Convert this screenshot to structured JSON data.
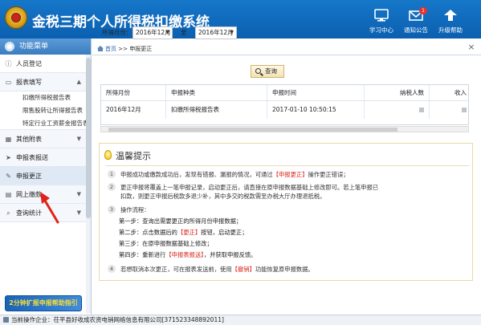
{
  "header": {
    "title": "金税三期个人所得税扣缴系统",
    "buttons": [
      {
        "label": "学习中心",
        "icon": "monitor-icon"
      },
      {
        "label": "通知公告",
        "icon": "mail-icon",
        "badge": "1"
      },
      {
        "label": "升级帮助",
        "icon": "upgrade-icon"
      }
    ]
  },
  "sidebar": {
    "heading": "功能菜单",
    "sections": [
      {
        "label": "人员登记",
        "icon": "info-icon"
      },
      {
        "label": "报表填写",
        "icon": "form-icon",
        "items": [
          "扣缴所得税报告表",
          "限售股转让所得报告表",
          "特定行业工资薪金报告表"
        ]
      },
      {
        "label": "其他附表",
        "icon": "grid-icon"
      },
      {
        "label": "申报表报送",
        "icon": "send-icon"
      },
      {
        "label": "申报更正",
        "icon": "pencil-icon"
      },
      {
        "label": "网上缴款",
        "icon": "payment-icon"
      },
      {
        "label": "查询统计",
        "icon": "search-icon"
      }
    ],
    "banner": "2分钟扩报申报帮助指引"
  },
  "tabs": {
    "home": "首页",
    "sep": ">>",
    "current": "申报更正"
  },
  "filter": {
    "label_month": "所得月份：",
    "from": "2016年12月",
    "to_label": "至",
    "to": "2016年12月",
    "query": "查询"
  },
  "table": {
    "columns": [
      "所得月份",
      "申报种类",
      "申报时间",
      "纳税人数",
      "收入"
    ],
    "rows": [
      [
        "2016年12月",
        "扣缴所得税报告表",
        "2017-01-10 10:50:15",
        "",
        ""
      ]
    ]
  },
  "tips": {
    "title": "温馨提示",
    "item1_a": "申报成功或缴款成功后，发现有错报、漏报的情况，可通过",
    "item1_red": "【申报更正】",
    "item1_b": "操作更正错误；",
    "item2_line1": "更正申报将覆盖上一笔申报记录，启动更正后，请直接在原申报数据基础上修改即可。若上笔申报已",
    "item2_line2": "扣款，则更正申报后税款多退少补，其中多交的税款需至办税大厅办理退抵税。",
    "item3": "操作流程：",
    "step1": "第一步：查询出需要更正的所得月份申报数据；",
    "step2_a": "第二步：点击数据后的",
    "step2_red": "【更正】",
    "step2_b": "按钮，启动更正；",
    "step3": "第三步：在原申报数据基础上修改；",
    "step4_a": "第四步：重新进行",
    "step4_red": "【申报表报送】",
    "step4_b": "，并获取申报反馈。",
    "item4_a": "若想取消本次更正，可在报表发送前，使用",
    "item4_red": "【撤销】",
    "item4_b": "功能恢复原申报数据。"
  },
  "status": {
    "text": "当前操作企业：茌平县好收成农资电销网络信息有限公司[371523348892011]"
  },
  "colors": {
    "header_blue": "#0b5fb0",
    "accent_red": "#d9261c",
    "pointer_red": "#e0231a"
  }
}
